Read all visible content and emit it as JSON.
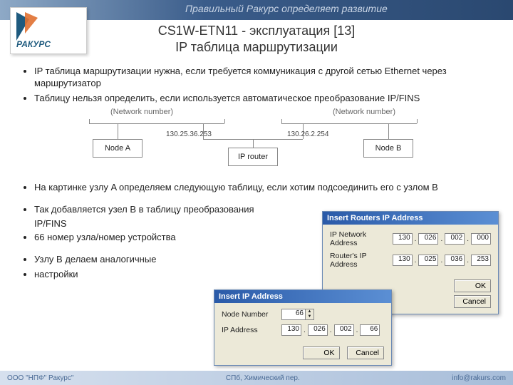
{
  "banner": {
    "tagline": "Правильный Ракурс определяет развитие"
  },
  "logo": {
    "brand": "РАКУРС"
  },
  "title": {
    "line1": "CS1W-ETN11 - эксплуатация [13]",
    "line2": "IP таблица маршрутизации"
  },
  "bullets": {
    "b1": "IP таблица маршрутизации нужна, если требуется коммуникация с другой сетью Ethernet через маршрутизатор",
    "b2": "Таблицу нельзя определить, если используется автоматическое преобразование IP/FINS",
    "b3": "На картинке узлу A определяем следующую таблицу, если хотим подсоединить его с узлом B",
    "b4": "Так добавляется узел B в таблицу преобразования",
    "b4_indent": "IP/FINS",
    "b5": "66 номер узла/номер устройства",
    "b6": "Узлу B делаем аналогичные",
    "b7": "настройки"
  },
  "diagram": {
    "net_label_left": "(Network number)",
    "net_label_right": "(Network number)",
    "node_a": "Node A",
    "router": "IP router",
    "node_b": "Node B",
    "ip_left": "130.25.36.253",
    "ip_right": "130.26.2.254"
  },
  "dlg_routers": {
    "title": "Insert Routers IP Address",
    "row1_label": "IP Network Address",
    "row1_ip": [
      "130",
      "026",
      "002",
      "000"
    ],
    "row2_label": "Router's IP Address",
    "row2_ip": [
      "130",
      "025",
      "036",
      "253"
    ],
    "ok": "OK",
    "cancel": "Cancel"
  },
  "dlg_ip": {
    "title": "Insert IP Address",
    "row1_label": "Node Number",
    "node_number": "66",
    "row2_label": "IP Address",
    "ip": [
      "130",
      "026",
      "002",
      "66"
    ],
    "ok": "OK",
    "cancel": "Cancel"
  },
  "footer": {
    "left": "ООО \"НПФ\" Ракурс\"",
    "mid": "СПб, Химический пер.",
    "right": "info@rakurs.com"
  }
}
